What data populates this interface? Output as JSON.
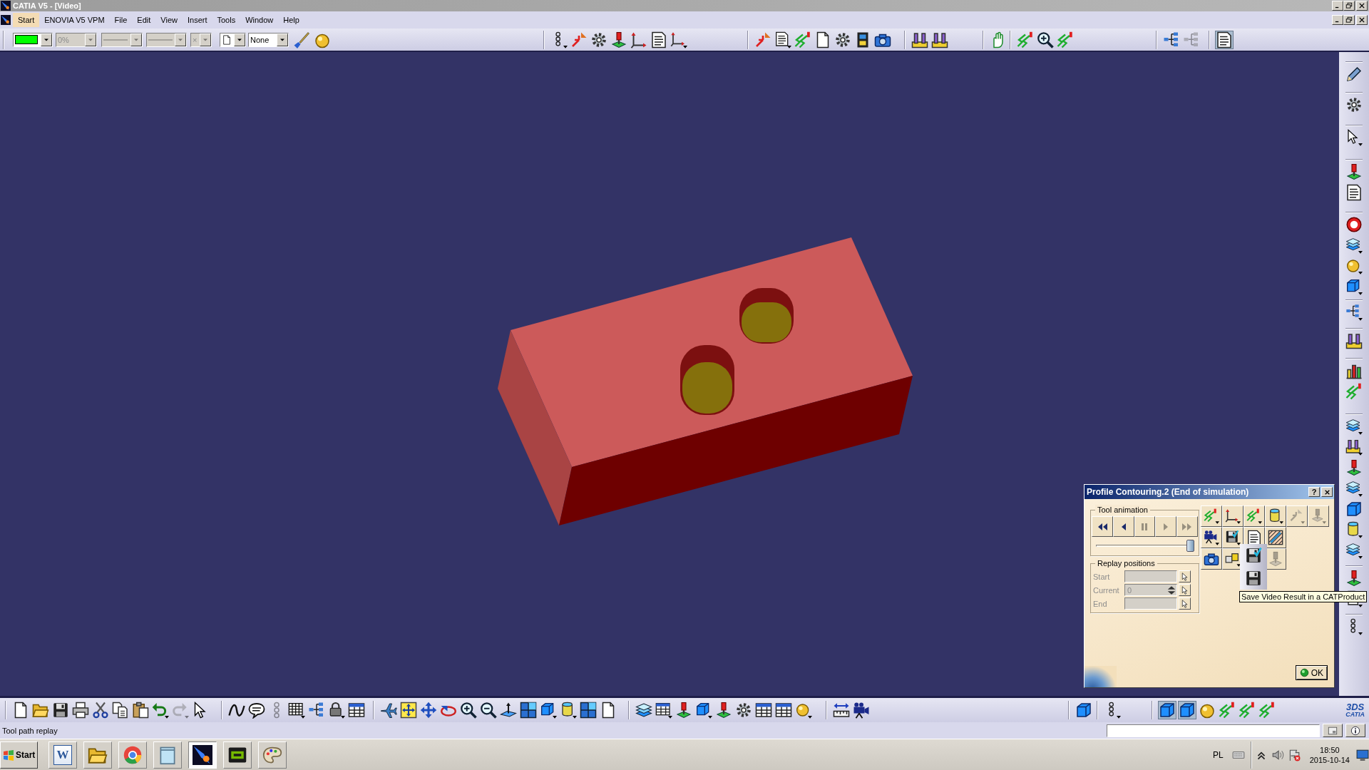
{
  "window": {
    "title": "CATIA V5 - [Video]"
  },
  "menu_bar": [
    {
      "label": "Start",
      "selected": true
    },
    {
      "label": "ENOVIA V5 VPM",
      "selected": false
    },
    {
      "label": "File",
      "selected": false
    },
    {
      "label": "Edit",
      "selected": false
    },
    {
      "label": "View",
      "selected": false
    },
    {
      "label": "Insert",
      "selected": false
    },
    {
      "label": "Tools",
      "selected": false
    },
    {
      "label": "Window",
      "selected": false
    },
    {
      "label": "Help",
      "selected": false
    }
  ],
  "properties_toolbar": [
    {
      "kind": "color",
      "color": "#00ff00",
      "disabled": false
    },
    {
      "kind": "text",
      "value": "0%",
      "disabled": true
    },
    {
      "kind": "line",
      "disabled": true
    },
    {
      "kind": "line",
      "disabled": true
    },
    {
      "kind": "text",
      "value": "×",
      "disabled": true
    },
    {
      "kind": "icon",
      "disabled": false
    },
    {
      "kind": "text",
      "value": "None",
      "disabled": false
    }
  ],
  "top_toolbar": [
    [
      {
        "disabled": false
      },
      {
        "disabled": false
      },
      {
        "disabled": false
      },
      {
        "disabled": false
      },
      {
        "disabled": false
      },
      {
        "disabled": false
      },
      {
        "disabled": false
      }
    ],
    [
      {
        "disabled": false
      },
      {
        "disabled": false
      },
      {
        "disabled": false
      },
      {
        "disabled": false
      },
      {
        "disabled": false
      },
      {
        "disabled": false
      },
      {
        "disabled": false
      }
    ],
    [
      {
        "disabled": false
      },
      {
        "disabled": false
      }
    ],
    [
      {
        "disabled": false
      }
    ],
    [
      {
        "disabled": false
      },
      {
        "disabled": false
      },
      {
        "disabled": false
      }
    ],
    [
      {
        "disabled": false
      },
      {
        "disabled": true
      }
    ],
    [
      {
        "disabled": false,
        "pressed": true
      }
    ]
  ],
  "right_toolbar": [
    [
      {
        "disabled": false
      }
    ],
    [
      {
        "disabled": false
      }
    ],
    [
      {
        "disabled": false
      }
    ],
    [
      {
        "disabled": false
      },
      {
        "disabled": false
      }
    ],
    [
      {
        "disabled": false
      },
      {
        "disabled": false
      },
      {
        "disabled": false
      },
      {
        "disabled": false
      }
    ],
    [
      {
        "disabled": false
      }
    ],
    [
      {
        "disabled": false
      }
    ],
    [
      {
        "disabled": false
      },
      {
        "disabled": false
      }
    ],
    [
      {
        "disabled": false
      },
      {
        "disabled": false
      },
      {
        "disabled": false
      },
      {
        "disabled": false
      },
      {
        "disabled": false
      },
      {
        "disabled": false
      },
      {
        "disabled": false
      }
    ],
    [
      {
        "disabled": false
      },
      {
        "disabled": false
      }
    ],
    [
      {
        "disabled": false
      }
    ]
  ],
  "dialog": {
    "title": "Profile Contouring.2 (End of simulation)",
    "help": "?",
    "tool_animation": {
      "title": "Tool animation",
      "player_buttons": [
        {
          "disabled": false
        },
        {
          "disabled": false
        },
        {
          "disabled": true
        },
        {
          "disabled": true
        },
        {
          "disabled": true
        }
      ],
      "slider": {
        "level": 1
      }
    },
    "replay_positions": {
      "title": "Replay positions",
      "fields": [
        {
          "kind": "text",
          "label": "Start",
          "disabled": true
        },
        {
          "kind": "spin",
          "label": "Current",
          "value": "0",
          "disabled": true
        },
        {
          "kind": "text",
          "label": "End",
          "disabled": true
        }
      ]
    },
    "commands": [
      [
        {
          "disabled": false
        },
        {
          "disabled": false
        },
        {
          "disabled": false
        },
        {
          "disabled": false
        },
        {
          "disabled": true
        },
        {
          "disabled": true
        }
      ],
      [
        {
          "disabled": false
        },
        {
          "disabled": false
        },
        {
          "disabled": false
        },
        {
          "disabled": false
        }
      ],
      [
        {
          "disabled": false
        },
        {
          "disabled": false
        },
        {
          "disabled": true
        }
      ]
    ],
    "flyout": {
      "items": [
        {
          "disabled": false
        },
        {
          "disabled": false
        }
      ],
      "tooltip": "Save Video Result in a CATProduct"
    },
    "ok": "OK"
  },
  "bottom_toolbar": [
    [
      {
        "disabled": false
      },
      {
        "disabled": false
      },
      {
        "disabled": false
      },
      {
        "disabled": false
      },
      {
        "disabled": false
      },
      {
        "disabled": false
      },
      {
        "disabled": false
      },
      {
        "disabled": false
      },
      {
        "disabled": true
      },
      {
        "disabled": false
      }
    ],
    [
      {
        "disabled": false
      },
      {
        "disabled": false
      },
      {
        "disabled": true
      },
      {
        "disabled": false
      },
      {
        "disabled": false
      },
      {
        "disabled": false
      },
      {
        "disabled": false
      }
    ],
    [
      {
        "disabled": false
      },
      {
        "disabled": false
      },
      {
        "disabled": false
      },
      {
        "disabled": false
      },
      {
        "disabled": false
      },
      {
        "disabled": false
      },
      {
        "disabled": false
      },
      {
        "disabled": false
      },
      {
        "disabled": false
      },
      {
        "disabled": false
      },
      {
        "disabled": false
      },
      {
        "disabled": false
      }
    ],
    [
      {
        "disabled": false
      },
      {
        "disabled": false
      },
      {
        "disabled": false
      },
      {
        "disabled": false
      },
      {
        "disabled": false
      },
      {
        "disabled": false
      },
      {
        "disabled": false
      },
      {
        "disabled": false
      },
      {
        "disabled": false
      }
    ],
    [
      {
        "disabled": false
      },
      {
        "disabled": false
      }
    ],
    [
      {
        "disabled": false
      }
    ],
    [
      {
        "disabled": false
      }
    ],
    [
      {
        "disabled": false,
        "pressed": true
      },
      {
        "disabled": false,
        "pressed": true
      },
      {
        "disabled": false,
        "pressed": false
      },
      {
        "disabled": false,
        "pressed": false
      },
      {
        "disabled": false,
        "pressed": false
      },
      {
        "disabled": false,
        "pressed": false
      }
    ]
  ],
  "logo": {
    "mark": "3DS",
    "name": "CATIA"
  },
  "status_bar": {
    "message": "Tool path replay"
  },
  "taskbar": {
    "start": "Start",
    "apps": [
      {
        "glyph": "W",
        "selected": false
      },
      {
        "selected": false
      },
      {
        "selected": false
      },
      {
        "selected": false
      },
      {
        "selected": true
      },
      {
        "selected": false
      },
      {
        "selected": false
      }
    ],
    "language": "PL",
    "time": "18:50",
    "date": "2015-10-14"
  }
}
